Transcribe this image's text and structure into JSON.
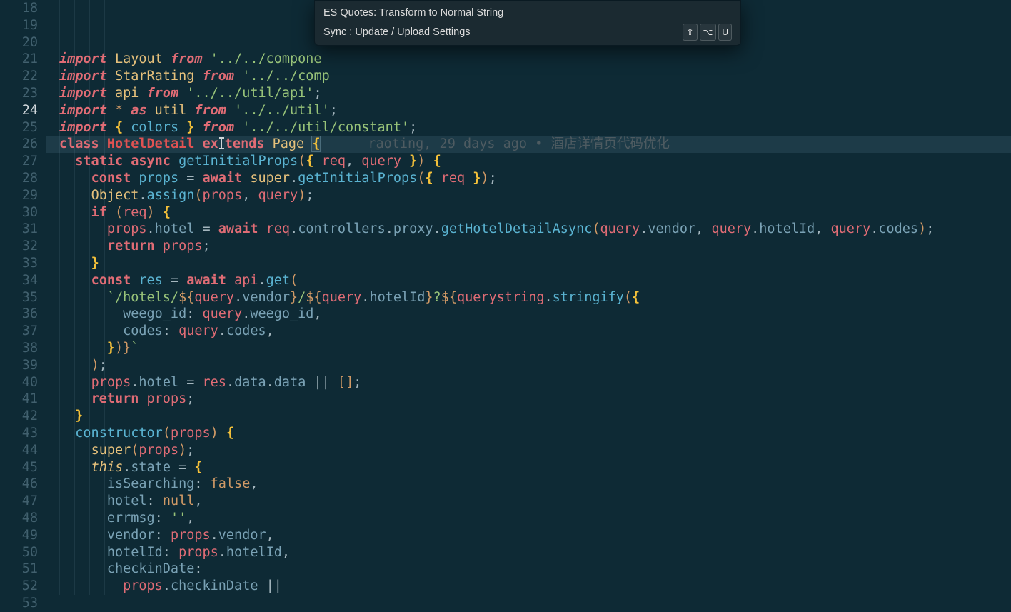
{
  "palette": {
    "items": [
      {
        "label": "ES Quotes: Transform to Normal String",
        "keys": []
      },
      {
        "label": "Sync : Update / Upload Settings",
        "keys": [
          "⇧",
          "⌥",
          "U"
        ]
      }
    ]
  },
  "blame": {
    "author": "raoting",
    "when": "29 days ago",
    "msg": "酒店详情页代码优化"
  },
  "lines": [
    {
      "n": 18,
      "tokens": [
        [
          "kw2",
          "import"
        ],
        [
          "pun",
          " "
        ],
        [
          "def",
          "Layout"
        ],
        [
          "pun",
          " "
        ],
        [
          "kw2",
          "from"
        ],
        [
          "pun",
          " "
        ],
        [
          "str",
          "'../../compone"
        ]
      ]
    },
    {
      "n": 19,
      "tokens": [
        [
          "kw2",
          "import"
        ],
        [
          "pun",
          " "
        ],
        [
          "def",
          "StarRating"
        ],
        [
          "pun",
          " "
        ],
        [
          "kw2",
          "from"
        ],
        [
          "pun",
          " "
        ],
        [
          "str",
          "'../../comp"
        ]
      ]
    },
    {
      "n": 20,
      "tokens": [
        [
          "kw2",
          "import"
        ],
        [
          "pun",
          " "
        ],
        [
          "def",
          "api"
        ],
        [
          "pun",
          " "
        ],
        [
          "kw2",
          "from"
        ],
        [
          "pun",
          " "
        ],
        [
          "str",
          "'../../util/api'"
        ],
        [
          "pun",
          ";"
        ]
      ]
    },
    {
      "n": 21,
      "tokens": [
        [
          "kw2",
          "import"
        ],
        [
          "pun",
          " "
        ],
        [
          "pn",
          "*"
        ],
        [
          "pun",
          " "
        ],
        [
          "kw2",
          "as"
        ],
        [
          "pun",
          " "
        ],
        [
          "def",
          "util"
        ],
        [
          "pun",
          " "
        ],
        [
          "kw2",
          "from"
        ],
        [
          "pun",
          " "
        ],
        [
          "str",
          "'../../util'"
        ],
        [
          "pun",
          ";"
        ]
      ]
    },
    {
      "n": 22,
      "tokens": [
        [
          "kw2",
          "import"
        ],
        [
          "pun",
          " "
        ],
        [
          "br",
          "{"
        ],
        [
          "pun",
          " "
        ],
        [
          "fn",
          "colors"
        ],
        [
          "pun",
          " "
        ],
        [
          "br",
          "}"
        ],
        [
          "pun",
          " "
        ],
        [
          "kw2",
          "from"
        ],
        [
          "pun",
          " "
        ],
        [
          "str",
          "'../../util/constant'"
        ],
        [
          "pun",
          ";"
        ]
      ]
    },
    {
      "n": 23,
      "tokens": []
    },
    {
      "n": 24,
      "active": true,
      "tokens": [
        [
          "kw",
          "class"
        ],
        [
          "pun",
          " "
        ],
        [
          "cls",
          "HotelDetail"
        ],
        [
          "pun",
          " "
        ],
        [
          "kw",
          "ex"
        ],
        [
          "__caret",
          ""
        ],
        [
          "kw",
          "tends"
        ],
        [
          "pun",
          " "
        ],
        [
          "def",
          "Page"
        ],
        [
          "pun",
          " "
        ],
        [
          "br bracket-hl",
          "{"
        ]
      ]
    },
    {
      "n": 25,
      "tokens": [
        [
          "pun",
          "  "
        ],
        [
          "kw",
          "static"
        ],
        [
          "pun",
          " "
        ],
        [
          "kw",
          "async"
        ],
        [
          "pun",
          " "
        ],
        [
          "fn",
          "getInitialProps"
        ],
        [
          "pn",
          "("
        ],
        [
          "br",
          "{"
        ],
        [
          "pun",
          " "
        ],
        [
          "id2",
          "req"
        ],
        [
          "pun",
          ","
        ],
        [
          "pun",
          " "
        ],
        [
          "id2",
          "query"
        ],
        [
          "pun",
          " "
        ],
        [
          "br",
          "}"
        ],
        [
          "pn",
          ")"
        ],
        [
          "pun",
          " "
        ],
        [
          "br",
          "{"
        ]
      ]
    },
    {
      "n": 26,
      "tokens": [
        [
          "pun",
          "    "
        ],
        [
          "kw",
          "const"
        ],
        [
          "pun",
          " "
        ],
        [
          "fn",
          "props"
        ],
        [
          "pun",
          " "
        ],
        [
          "pun",
          "="
        ],
        [
          "pun",
          " "
        ],
        [
          "kw",
          "await"
        ],
        [
          "pun",
          " "
        ],
        [
          "def",
          "super"
        ],
        [
          "pun",
          "."
        ],
        [
          "fn",
          "getInitialProps"
        ],
        [
          "pn",
          "("
        ],
        [
          "br",
          "{"
        ],
        [
          "pun",
          " "
        ],
        [
          "id2",
          "req"
        ],
        [
          "pun",
          " "
        ],
        [
          "br",
          "}"
        ],
        [
          "pn",
          ")"
        ],
        [
          "pun",
          ";"
        ]
      ]
    },
    {
      "n": 27,
      "tokens": [
        [
          "pun",
          "    "
        ],
        [
          "def",
          "Object"
        ],
        [
          "pun",
          "."
        ],
        [
          "fn",
          "assign"
        ],
        [
          "pn",
          "("
        ],
        [
          "id2",
          "props"
        ],
        [
          "pun",
          ","
        ],
        [
          "pun",
          " "
        ],
        [
          "id2",
          "query"
        ],
        [
          "pn",
          ")"
        ],
        [
          "pun",
          ";"
        ]
      ]
    },
    {
      "n": 28,
      "tokens": [
        [
          "pun",
          "    "
        ],
        [
          "kw",
          "if"
        ],
        [
          "pun",
          " "
        ],
        [
          "pn",
          "("
        ],
        [
          "id2",
          "req"
        ],
        [
          "pn",
          ")"
        ],
        [
          "pun",
          " "
        ],
        [
          "br",
          "{"
        ]
      ]
    },
    {
      "n": 29,
      "tokens": [
        [
          "pun",
          "      "
        ],
        [
          "id2",
          "props"
        ],
        [
          "pun",
          "."
        ],
        [
          "prop",
          "hotel"
        ],
        [
          "pun",
          " "
        ],
        [
          "pun",
          "="
        ],
        [
          "pun",
          " "
        ],
        [
          "kw",
          "await"
        ],
        [
          "pun",
          " "
        ],
        [
          "id2",
          "req"
        ],
        [
          "pun",
          "."
        ],
        [
          "prop",
          "controllers"
        ],
        [
          "pun",
          "."
        ],
        [
          "prop",
          "proxy"
        ],
        [
          "pun",
          "."
        ],
        [
          "fn",
          "getHotelDetailAsync"
        ],
        [
          "pn",
          "("
        ],
        [
          "id2",
          "query"
        ],
        [
          "pun",
          "."
        ],
        [
          "prop",
          "vendor"
        ],
        [
          "pun",
          ","
        ],
        [
          "pun",
          " "
        ],
        [
          "id2",
          "query"
        ],
        [
          "pun",
          "."
        ],
        [
          "prop",
          "hotelId"
        ],
        [
          "pun",
          ","
        ],
        [
          "pun",
          " "
        ],
        [
          "id2",
          "query"
        ],
        [
          "pun",
          "."
        ],
        [
          "prop",
          "codes"
        ],
        [
          "pn",
          ")"
        ],
        [
          "pun",
          ";"
        ]
      ]
    },
    {
      "n": 30,
      "tokens": [
        [
          "pun",
          "      "
        ],
        [
          "kw",
          "return"
        ],
        [
          "pun",
          " "
        ],
        [
          "id2",
          "props"
        ],
        [
          "pun",
          ";"
        ]
      ]
    },
    {
      "n": 31,
      "tokens": [
        [
          "pun",
          "    "
        ],
        [
          "br",
          "}"
        ]
      ]
    },
    {
      "n": 32,
      "tokens": []
    },
    {
      "n": 33,
      "tokens": [
        [
          "pun",
          "    "
        ],
        [
          "kw",
          "const"
        ],
        [
          "pun",
          " "
        ],
        [
          "fn",
          "res"
        ],
        [
          "pun",
          " "
        ],
        [
          "pun",
          "="
        ],
        [
          "pun",
          " "
        ],
        [
          "kw",
          "await"
        ],
        [
          "pun",
          " "
        ],
        [
          "id2",
          "api"
        ],
        [
          "pun",
          "."
        ],
        [
          "fn",
          "get"
        ],
        [
          "pn",
          "("
        ]
      ]
    },
    {
      "n": 34,
      "tokens": [
        [
          "pun",
          "      "
        ],
        [
          "str",
          "`/hotels/"
        ],
        [
          "pn",
          "${"
        ],
        [
          "id2",
          "query"
        ],
        [
          "pun",
          "."
        ],
        [
          "prop",
          "vendor"
        ],
        [
          "pn",
          "}"
        ],
        [
          "str",
          "/"
        ],
        [
          "pn",
          "${"
        ],
        [
          "id2",
          "query"
        ],
        [
          "pun",
          "."
        ],
        [
          "prop",
          "hotelId"
        ],
        [
          "pn",
          "}"
        ],
        [
          "str",
          "?"
        ],
        [
          "pn",
          "${"
        ],
        [
          "id2",
          "querystring"
        ],
        [
          "pun",
          "."
        ],
        [
          "fn",
          "stringify"
        ],
        [
          "pn",
          "("
        ],
        [
          "br",
          "{"
        ]
      ]
    },
    {
      "n": 35,
      "tokens": [
        [
          "pun",
          "        "
        ],
        [
          "prop",
          "weego_id"
        ],
        [
          "pun",
          ":"
        ],
        [
          "pun",
          " "
        ],
        [
          "id2",
          "query"
        ],
        [
          "pun",
          "."
        ],
        [
          "prop",
          "weego_id"
        ],
        [
          "pun",
          ","
        ]
      ]
    },
    {
      "n": 36,
      "tokens": [
        [
          "pun",
          "        "
        ],
        [
          "prop",
          "codes"
        ],
        [
          "pun",
          ":"
        ],
        [
          "pun",
          " "
        ],
        [
          "id2",
          "query"
        ],
        [
          "pun",
          "."
        ],
        [
          "prop",
          "codes"
        ],
        [
          "pun",
          ","
        ]
      ]
    },
    {
      "n": 37,
      "tokens": [
        [
          "pun",
          "      "
        ],
        [
          "br",
          "}"
        ],
        [
          "pn",
          ")"
        ],
        [
          "pn",
          "}"
        ],
        [
          "str",
          "`"
        ]
      ]
    },
    {
      "n": 38,
      "tokens": [
        [
          "pun",
          "    "
        ],
        [
          "pn",
          ")"
        ],
        [
          "pun",
          ";"
        ]
      ]
    },
    {
      "n": 39,
      "tokens": [
        [
          "pun",
          "    "
        ],
        [
          "id2",
          "props"
        ],
        [
          "pun",
          "."
        ],
        [
          "prop",
          "hotel"
        ],
        [
          "pun",
          " "
        ],
        [
          "pun",
          "="
        ],
        [
          "pun",
          " "
        ],
        [
          "id2",
          "res"
        ],
        [
          "pun",
          "."
        ],
        [
          "prop",
          "data"
        ],
        [
          "pun",
          "."
        ],
        [
          "prop",
          "data"
        ],
        [
          "pun",
          " "
        ],
        [
          "pun",
          "||"
        ],
        [
          "pun",
          " "
        ],
        [
          "pn",
          "["
        ],
        [
          "pn",
          "]"
        ],
        [
          "pun",
          ";"
        ]
      ]
    },
    {
      "n": 40,
      "tokens": []
    },
    {
      "n": 41,
      "tokens": [
        [
          "pun",
          "    "
        ],
        [
          "kw",
          "return"
        ],
        [
          "pun",
          " "
        ],
        [
          "id2",
          "props"
        ],
        [
          "pun",
          ";"
        ]
      ]
    },
    {
      "n": 42,
      "tokens": [
        [
          "pun",
          "  "
        ],
        [
          "br",
          "}"
        ]
      ]
    },
    {
      "n": 43,
      "tokens": []
    },
    {
      "n": 44,
      "tokens": [
        [
          "pun",
          "  "
        ],
        [
          "fn",
          "constructor"
        ],
        [
          "pn",
          "("
        ],
        [
          "id2",
          "props"
        ],
        [
          "pn",
          ")"
        ],
        [
          "pun",
          " "
        ],
        [
          "br",
          "{"
        ]
      ]
    },
    {
      "n": 45,
      "tokens": [
        [
          "pun",
          "    "
        ],
        [
          "def",
          "super"
        ],
        [
          "pn",
          "("
        ],
        [
          "id2",
          "props"
        ],
        [
          "pn",
          ")"
        ],
        [
          "pun",
          ";"
        ]
      ]
    },
    {
      "n": 46,
      "tokens": [
        [
          "pun",
          "    "
        ],
        [
          "this",
          "this"
        ],
        [
          "pun",
          "."
        ],
        [
          "prop",
          "state"
        ],
        [
          "pun",
          " "
        ],
        [
          "pun",
          "="
        ],
        [
          "pun",
          " "
        ],
        [
          "br",
          "{"
        ]
      ]
    },
    {
      "n": 47,
      "tokens": [
        [
          "pun",
          "      "
        ],
        [
          "prop",
          "isSearching"
        ],
        [
          "pun",
          ":"
        ],
        [
          "pun",
          " "
        ],
        [
          "id4",
          "false"
        ],
        [
          "pun",
          ","
        ]
      ]
    },
    {
      "n": 48,
      "tokens": [
        [
          "pun",
          "      "
        ],
        [
          "prop",
          "hotel"
        ],
        [
          "pun",
          ":"
        ],
        [
          "pun",
          " "
        ],
        [
          "id4",
          "null"
        ],
        [
          "pun",
          ","
        ]
      ]
    },
    {
      "n": 49,
      "tokens": [
        [
          "pun",
          "      "
        ],
        [
          "prop",
          "errmsg"
        ],
        [
          "pun",
          ":"
        ],
        [
          "pun",
          " "
        ],
        [
          "str",
          "''"
        ],
        [
          "pun",
          ","
        ]
      ]
    },
    {
      "n": 50,
      "tokens": [
        [
          "pun",
          "      "
        ],
        [
          "prop",
          "vendor"
        ],
        [
          "pun",
          ":"
        ],
        [
          "pun",
          " "
        ],
        [
          "id2",
          "props"
        ],
        [
          "pun",
          "."
        ],
        [
          "prop",
          "vendor"
        ],
        [
          "pun",
          ","
        ]
      ]
    },
    {
      "n": 51,
      "tokens": [
        [
          "pun",
          "      "
        ],
        [
          "prop",
          "hotelId"
        ],
        [
          "pun",
          ":"
        ],
        [
          "pun",
          " "
        ],
        [
          "id2",
          "props"
        ],
        [
          "pun",
          "."
        ],
        [
          "prop",
          "hotelId"
        ],
        [
          "pun",
          ","
        ]
      ]
    },
    {
      "n": 52,
      "tokens": [
        [
          "pun",
          "      "
        ],
        [
          "prop",
          "checkinDate"
        ],
        [
          "pun",
          ":"
        ]
      ]
    },
    {
      "n": 53,
      "tokens": [
        [
          "pun",
          "        "
        ],
        [
          "id2",
          "props"
        ],
        [
          "pun",
          "."
        ],
        [
          "prop",
          "checkinDate"
        ],
        [
          "pun",
          " "
        ],
        [
          "pun",
          "||"
        ]
      ]
    }
  ]
}
